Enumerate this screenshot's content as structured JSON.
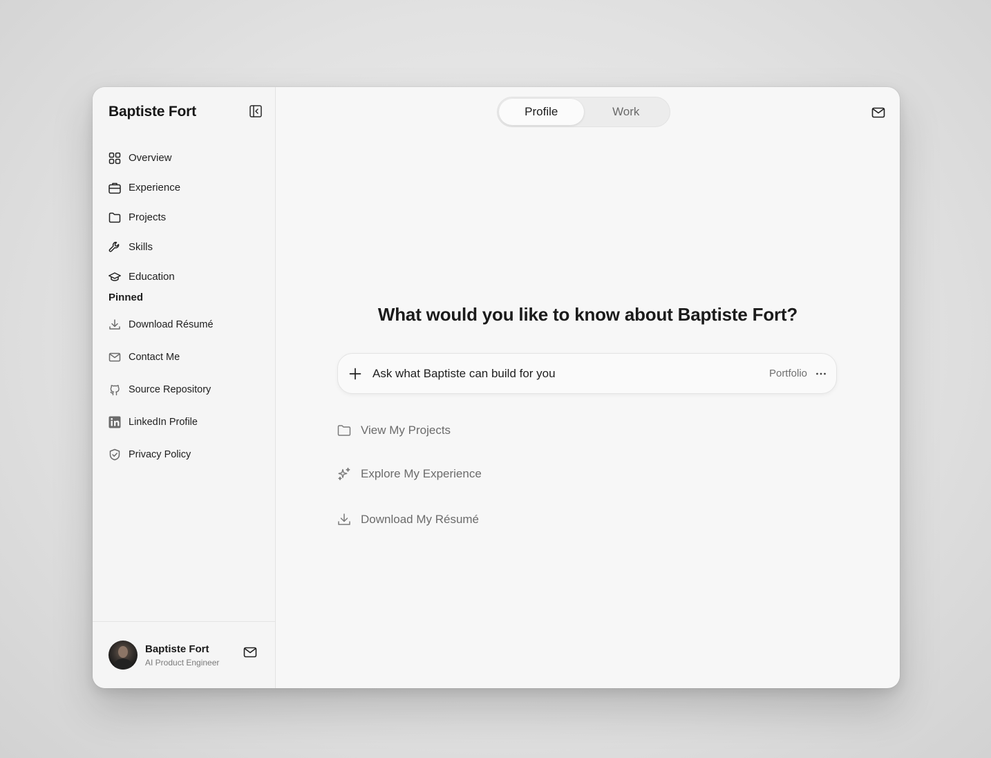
{
  "sidebar": {
    "brand": "Baptiste Fort",
    "nav": [
      {
        "label": "Overview",
        "icon": "grid-icon"
      },
      {
        "label": "Experience",
        "icon": "briefcase-icon"
      },
      {
        "label": "Projects",
        "icon": "folder-icon"
      },
      {
        "label": "Skills",
        "icon": "wrench-icon"
      },
      {
        "label": "Education",
        "icon": "graduation-cap-icon"
      }
    ],
    "pinned_label": "Pinned",
    "pinned": [
      {
        "label": "Download Résumé",
        "icon": "download-icon"
      },
      {
        "label": "Contact Me",
        "icon": "mail-icon"
      },
      {
        "label": "Source Repository",
        "icon": "github-icon"
      },
      {
        "label": "LinkedIn Profile",
        "icon": "linkedin-icon"
      },
      {
        "label": "Privacy Policy",
        "icon": "shield-icon"
      }
    ],
    "user": {
      "name": "Baptiste Fort",
      "role": "AI Product Engineer"
    }
  },
  "header": {
    "tabs": [
      {
        "label": "Profile",
        "active": true
      },
      {
        "label": "Work",
        "active": false
      }
    ]
  },
  "main": {
    "headline": "What would you like to know about Baptiste Fort?",
    "ask": {
      "placeholder": "Ask what Baptiste can build for you",
      "mode": "Portfolio"
    },
    "suggestions": [
      {
        "label": "View My Projects",
        "icon": "folder-icon"
      },
      {
        "label": "Explore My Experience",
        "icon": "sparkles-icon"
      },
      {
        "label": "Download My Résumé",
        "icon": "download-icon"
      }
    ]
  }
}
